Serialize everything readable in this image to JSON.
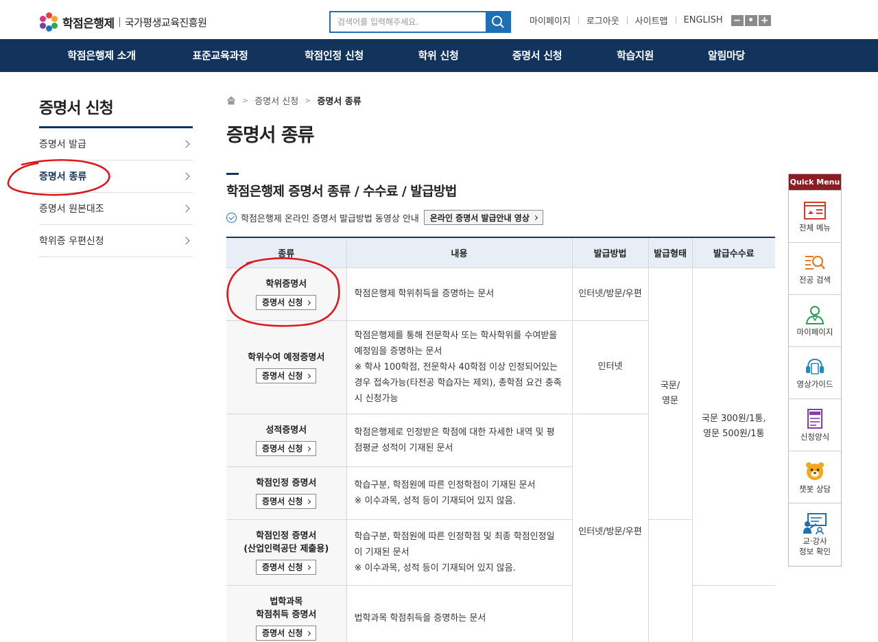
{
  "header": {
    "brand": "학점은행제",
    "org": "국가평생교육진흥원",
    "search_placeholder": "검색어를 입력해주세요.",
    "util_links": [
      "마이페이지",
      "로그아웃",
      "사이트맵",
      "ENGLISH"
    ],
    "zoom": [
      "−",
      "•",
      "+"
    ]
  },
  "gnb": [
    "학점은행제 소개",
    "표준교육과정",
    "학점인정 신청",
    "학위 신청",
    "증명서 신청",
    "학습지원",
    "알림마당"
  ],
  "lnb": {
    "title": "증명서 신청",
    "items": [
      "증명서 발급",
      "증명서 종류",
      "증명서 원본대조",
      "학위증 우편신청"
    ],
    "active_index": 1
  },
  "breadcrumb": {
    "level1": "증명서 신청",
    "current": "증명서 종류"
  },
  "page_title": "증명서 종류",
  "section": {
    "title": "학점은행제 증명서 종류 / 수수료 / 발급방법",
    "notice": "학점은행제 온라인 증명서 발급방법 동영상 안내",
    "video_button": "온라인 증명서 발급안내 영상"
  },
  "table": {
    "headers": [
      "종류",
      "내용",
      "발급방법",
      "발급형태",
      "발급수수료"
    ],
    "apply_label": "증명서 신청",
    "rows": [
      {
        "kind": [
          "학위증명서"
        ],
        "desc": [
          "학점은행제 학위취득을 증명하는 문서"
        ]
      },
      {
        "kind": [
          "학위수여 예정증명서"
        ],
        "desc": [
          "학점은행제를 통해 전문학사 또는 학사학위를 수여받을",
          "예정임을 증명하는 문서",
          "※ 학사 100학점, 전문학사 40학점 이상 인정되어있는",
          "경우 접속가능(타전공 학습자는 제외), 총학점 요건 충족",
          "시 신청가능"
        ]
      },
      {
        "kind": [
          "성적증명서"
        ],
        "desc": [
          "학점은행제로 인정받은 학점에 대한 자세한 내역 및 평",
          "점평균 성적이 기재된 문서"
        ]
      },
      {
        "kind": [
          "학점인정 증명서"
        ],
        "desc": [
          "학습구분, 학점원에 따른 인정학점이 기재된 문서",
          "※ 이수과목, 성적 등이 기재되어 있지 않음."
        ]
      },
      {
        "kind": [
          "학점인정 증명서",
          "(산업인력공단 제출용)"
        ],
        "desc": [
          "학습구분, 학점원에 따른 인정학점 및 최종 학점인정일",
          "이 기재된 문서",
          "※ 이수과목, 성적 등이 기재되어 있지 않음."
        ]
      },
      {
        "kind": [
          "법학과목",
          "학점취득 증명서"
        ],
        "desc": [
          "법학과목 학점취득을 증명하는 문서"
        ]
      }
    ],
    "method_groups": [
      "인터넷/방문/우편",
      "인터넷",
      "인터넷/방문/우편"
    ],
    "form": [
      "국문/",
      "영문"
    ],
    "fee": [
      "국문 300원/1통,",
      "영문 500원/1통"
    ]
  },
  "quick_menu": {
    "title": "Quick Menu",
    "items": [
      {
        "label": [
          "전체 메뉴"
        ],
        "icon": "all-menu-icon"
      },
      {
        "label": [
          "전공 검색"
        ],
        "icon": "major-search-icon"
      },
      {
        "label": [
          "마이페이지"
        ],
        "icon": "mypage-icon"
      },
      {
        "label": [
          "영상가이드"
        ],
        "icon": "video-guide-icon"
      },
      {
        "label": [
          "신청양식"
        ],
        "icon": "form-icon"
      },
      {
        "label": [
          "챗봇 상담"
        ],
        "icon": "chatbot-icon"
      },
      {
        "label": [
          "교·강사",
          "정보 확인"
        ],
        "icon": "instructor-icon"
      }
    ]
  },
  "colors": {
    "navy": "#12345c",
    "blue": "#1e6fb5",
    "quick_red": "#8c1c24",
    "annotation": "#e0161b"
  }
}
